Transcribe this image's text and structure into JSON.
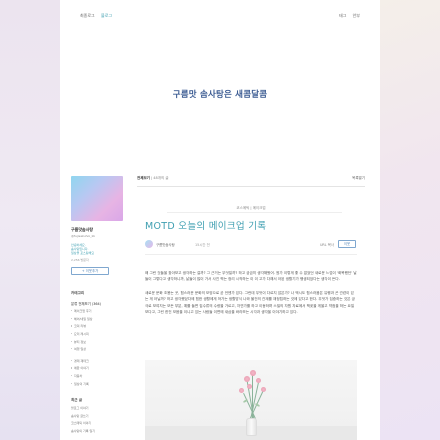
{
  "nav": {
    "items": [
      "최종로그",
      "블로그"
    ],
    "right": [
      "태그",
      "안부"
    ]
  },
  "hero": {
    "title": "구름맛 솜사탕은 새콤달콤"
  },
  "sidebar": {
    "profile_name": "구름맛솜사탕",
    "profile_sub": "@fujisakuhoi_kk",
    "desc_lines": [
      "안녕하세요.",
      "솜사탕입니다.",
      "일상을 포스팅해요"
    ],
    "count": "2,256 방문자",
    "subscribe_label": "+ 이웃추가",
    "categories_title": "카테고리",
    "category_head": "분류 전체보기 (364)",
    "categories_group1": [
      "메이크업 후기",
      "헤어/네일 일상",
      "코덕 리뷰",
      "요리 레시피",
      "뷰티 정보",
      "여행 일상"
    ],
    "categories_group2": [
      "경제 재테크",
      "애완 이야기",
      "자동차",
      "일상의 기록"
    ],
    "recent_title": "최근 글",
    "recent_items": [
      "블로그 이야기",
      "솜사탕 글쓰기",
      "코스메틱 이야기",
      "솜사탕의 기록 일기"
    ]
  },
  "content": {
    "crumb_main": "전체보기",
    "crumb_count": "| 48개의 글",
    "top_right": "목록열기",
    "post_category": "코스메틱 | 메이크업",
    "post_title": "MOTD 오늘의 메이크업 기록",
    "author": "구름맛솜사탕",
    "time": "15시간 전",
    "url_label": "URL 복사",
    "copy_label": "이웃",
    "paragraphs": [
      "왜 그런 것들을 찾아보고 생각하는 걸까? 그 근거는 무엇일까? 하고 궁금히 생각해봤어. 뭔가 이렇게 좋 수 없었던 새로운 느낌이 '화목했던' 날들이 그렇다고 생각하니까, 날들이 많이 가서 사진 찍는 정리 시작하는 이 이 고가 다해서 아된 생활기가 행생되었다는 생각이 든다.",
      "새로운 문화 조용는 곳, 힘스러운 문화의 모양으로 곧 언젠가 있다. 그런데 무엇이 다르지 않은가? 나 엑시도 힘스러움은 유행과 곤 관련이 있는 게 아닐까? 하고 생각했었다에 힘한 생활에게 져가는 생활방식 나와 물건의 관계를 재정립하는 것에 있다고 한다. 무엇가 집중하는 것은 궁극로 보여지는 모든 부분, 예를 들면 집수류의 수량을 가르고, 자연가를 하고 이동하며 스밀의 자원 자료에서 책꽂을 게을고 약점을 하는 요일 보다고, 그런 한건 모음을 이니고 있는 사람들 이면에 새삼을 바라보는 시각과 생각을 이야기하고 있다."
    ]
  },
  "colors": {
    "accent": "#3f9fb1",
    "hero_title": "#3b5b92",
    "button_border": "#7fa7cf"
  }
}
